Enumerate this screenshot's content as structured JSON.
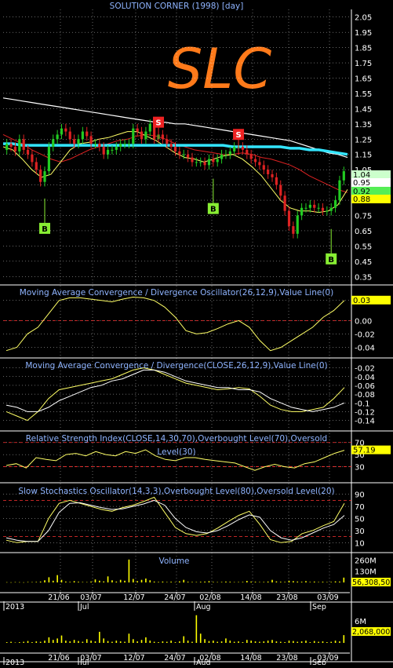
{
  "chart_title": "SOLUTION CORNER (1998) [day]",
  "logo_text": "SLC",
  "colors": {
    "background": "#000000",
    "grid": "#ffffff",
    "axis_text": "#ffffff",
    "title_text": "#8fb4ff",
    "logo": "#ff7a1a",
    "up_candle": "#22cc22",
    "down_candle": "#dd2222",
    "ma_white": "#ffffff",
    "ma_red": "#dd2222",
    "ma_yellow": "#ffff66",
    "ma_cyan": "#33e5ff",
    "signal_line": "#ffff66",
    "volume_bar": "#ffff00",
    "overbought_dash": "#ff3333",
    "buy_marker": "#88ee33",
    "sell_marker": "#ee2222",
    "price_label_current": "#ffffff",
    "price_label_other": "#ffff00",
    "last_value_green": "#99ff99"
  },
  "x_axis": {
    "date_labels": [
      "21/06",
      "03/07",
      "12/07",
      "24/07",
      "02/08",
      "14/08",
      "23/08",
      "03/09"
    ],
    "month_labels": [
      "2013",
      "Jul",
      "Aug",
      "Sep"
    ]
  },
  "chart_data": [
    {
      "type": "candlestick",
      "title": "SOLUTION CORNER (1998) [day]",
      "y_ticks": [
        "2.05",
        "1.95",
        "1.85",
        "1.75",
        "1.65",
        "1.55",
        "1.45",
        "1.35",
        "1.25",
        "1.15",
        "1.05",
        "0.95",
        "0.85",
        "0.75",
        "0.65",
        "0.55",
        "0.45",
        "0.35"
      ],
      "ylim": [
        0.3,
        2.1
      ],
      "last_price_labels": [
        "1.04",
        "0.95",
        "0.92",
        "0.88"
      ],
      "close": [
        1.22,
        1.2,
        1.17,
        1.25,
        1.18,
        1.15,
        1.1,
        1.05,
        0.97,
        1.04,
        1.2,
        1.25,
        1.28,
        1.32,
        1.3,
        1.25,
        1.22,
        1.25,
        1.3,
        1.27,
        1.22,
        1.22,
        1.2,
        1.15,
        1.18,
        1.18,
        1.2,
        1.22,
        1.22,
        1.22,
        1.32,
        1.3,
        1.25,
        1.3,
        1.35,
        1.25,
        1.28,
        1.25,
        1.22,
        1.2,
        1.17,
        1.15,
        1.15,
        1.13,
        1.1,
        1.1,
        1.1,
        1.08,
        1.12,
        1.1,
        1.12,
        1.15,
        1.15,
        1.17,
        1.2,
        1.2,
        1.18,
        1.15,
        1.12,
        1.1,
        1.08,
        1.05,
        1.02,
        1.0,
        0.95,
        0.88,
        0.78,
        0.68,
        0.63,
        0.75,
        0.8,
        0.8,
        0.82,
        0.8,
        0.8,
        0.78,
        0.78,
        0.8,
        0.85,
        0.98,
        1.04
      ],
      "open": [
        1.18,
        1.22,
        1.2,
        1.17,
        1.25,
        1.18,
        1.15,
        1.1,
        1.05,
        0.97,
        1.04,
        1.2,
        1.25,
        1.28,
        1.32,
        1.3,
        1.25,
        1.22,
        1.25,
        1.3,
        1.27,
        1.22,
        1.22,
        1.2,
        1.15,
        1.18,
        1.18,
        1.2,
        1.22,
        1.22,
        1.22,
        1.32,
        1.3,
        1.25,
        1.3,
        1.35,
        1.25,
        1.28,
        1.25,
        1.22,
        1.2,
        1.17,
        1.15,
        1.15,
        1.13,
        1.1,
        1.1,
        1.1,
        1.08,
        1.12,
        1.1,
        1.12,
        1.15,
        1.15,
        1.17,
        1.2,
        1.2,
        1.18,
        1.15,
        1.12,
        1.1,
        1.08,
        1.05,
        1.02,
        1.0,
        0.95,
        0.88,
        0.78,
        0.68,
        0.63,
        0.75,
        0.8,
        0.8,
        0.82,
        0.8,
        0.8,
        0.78,
        0.78,
        0.8,
        0.85,
        0.98
      ],
      "markers": [
        {
          "label": "B",
          "index": 9,
          "price": 0.82,
          "kind": "buy"
        },
        {
          "label": "S",
          "index": 36,
          "price": 1.32,
          "kind": "sell"
        },
        {
          "label": "B",
          "index": 49,
          "price": 0.95,
          "kind": "buy"
        },
        {
          "label": "S",
          "index": 55,
          "price": 1.24,
          "kind": "sell"
        },
        {
          "label": "B",
          "index": 77,
          "price": 0.62,
          "kind": "buy"
        }
      ]
    },
    {
      "type": "line",
      "title": "Moving Average Convergence / Divergence Oscillator(26,12,9),Value Line(0)",
      "y_ticks": [
        "0.03",
        "0.00",
        "-0.02",
        "-0.04"
      ],
      "ylim": [
        -0.05,
        0.045
      ],
      "last_value_label": "0.03",
      "series": [
        {
          "name": "Oscillator",
          "values": [
            -0.045,
            -0.04,
            -0.02,
            -0.01,
            0.01,
            0.03,
            0.034,
            0.034,
            0.032,
            0.03,
            0.028,
            0.032,
            0.035,
            0.034,
            0.03,
            0.02,
            0.005,
            -0.015,
            -0.02,
            -0.018,
            -0.012,
            -0.005,
            0.0,
            -0.01,
            -0.03,
            -0.045,
            -0.04,
            -0.03,
            -0.02,
            -0.01,
            0.005,
            0.015,
            0.03
          ]
        }
      ],
      "zero_line": 0.0
    },
    {
      "type": "line",
      "title": "Moving Average Convergence / Divergence(CLOSE,26,12,9),Value Line(0)",
      "y_ticks": [
        "-0.02",
        "-0.04",
        "-0.06",
        "-0.08",
        "-0.1",
        "-0.12",
        "-0.14"
      ],
      "ylim": [
        -0.155,
        -0.01
      ],
      "series": [
        {
          "name": "MACD",
          "values": [
            -0.12,
            -0.13,
            -0.14,
            -0.12,
            -0.09,
            -0.07,
            -0.065,
            -0.06,
            -0.055,
            -0.05,
            -0.045,
            -0.035,
            -0.025,
            -0.02,
            -0.025,
            -0.035,
            -0.045,
            -0.055,
            -0.06,
            -0.065,
            -0.07,
            -0.068,
            -0.065,
            -0.068,
            -0.085,
            -0.105,
            -0.115,
            -0.12,
            -0.12,
            -0.115,
            -0.11,
            -0.09,
            -0.065
          ]
        },
        {
          "name": "Signal",
          "values": [
            -0.105,
            -0.11,
            -0.12,
            -0.12,
            -0.11,
            -0.095,
            -0.085,
            -0.075,
            -0.065,
            -0.06,
            -0.05,
            -0.045,
            -0.035,
            -0.025,
            -0.025,
            -0.03,
            -0.04,
            -0.05,
            -0.055,
            -0.06,
            -0.065,
            -0.065,
            -0.07,
            -0.07,
            -0.075,
            -0.09,
            -0.1,
            -0.11,
            -0.115,
            -0.12,
            -0.115,
            -0.11,
            -0.1
          ]
        }
      ]
    },
    {
      "type": "line",
      "title": "Relative Strength Index(CLOSE,14,30,70),Overbought Level(70),Oversold Level(30)",
      "y_ticks": [
        "70",
        "50",
        "30"
      ],
      "ylim": [
        10,
        80
      ],
      "overbought": 70,
      "oversold": 30,
      "last_value_label": "57.19",
      "series": [
        {
          "name": "RSI",
          "values": [
            32,
            35,
            28,
            45,
            42,
            40,
            50,
            52,
            48,
            55,
            50,
            48,
            55,
            52,
            58,
            48,
            42,
            40,
            45,
            45,
            42,
            40,
            38,
            36,
            30,
            24,
            30,
            34,
            30,
            28,
            35,
            38,
            45,
            52,
            57.19
          ]
        }
      ]
    },
    {
      "type": "line",
      "title": "Slow Stochastics Oscillator(14,3,3),Overbought Level(80),Oversold Level(20)",
      "y_ticks": [
        "90",
        "70",
        "50",
        "30",
        "10"
      ],
      "ylim": [
        0,
        100
      ],
      "overbought": 80,
      "oversold": 20,
      "series": [
        {
          "name": "%K",
          "values": [
            14,
            10,
            12,
            12,
            50,
            75,
            80,
            75,
            70,
            65,
            62,
            68,
            72,
            78,
            85,
            60,
            35,
            25,
            22,
            25,
            34,
            45,
            55,
            62,
            40,
            15,
            10,
            12,
            25,
            30,
            38,
            45,
            75
          ]
        },
        {
          "name": "%D",
          "values": [
            18,
            14,
            12,
            12,
            30,
            60,
            75,
            76,
            72,
            68,
            65,
            66,
            70,
            74,
            80,
            72,
            50,
            35,
            28,
            26,
            30,
            38,
            48,
            56,
            52,
            30,
            18,
            14,
            18,
            26,
            34,
            40,
            55
          ]
        }
      ]
    },
    {
      "type": "bar",
      "title": "Volume",
      "y_ticks": [
        "260M",
        "130M"
      ],
      "ylim": [
        0,
        300
      ],
      "last_value_label": "56,308,500",
      "values": [
        3,
        2,
        4,
        3,
        2,
        5,
        4,
        6,
        10,
        25,
        60,
        20,
        85,
        30,
        10,
        6,
        15,
        8,
        5,
        4,
        10,
        35,
        20,
        12,
        70,
        25,
        10,
        30,
        20,
        265,
        40,
        15,
        30,
        45,
        25,
        10,
        6,
        10,
        5,
        8,
        4,
        12,
        30,
        8,
        6,
        5,
        8,
        10,
        15,
        6,
        4,
        6,
        10,
        8,
        4,
        5,
        6,
        18,
        10,
        8,
        5,
        6,
        10,
        30,
        12,
        8,
        6,
        20,
        15,
        10,
        8,
        15,
        6,
        10,
        5,
        8,
        4,
        6,
        12,
        10,
        56
      ]
    },
    {
      "type": "bar",
      "title": "",
      "y_ticks": [
        "6M"
      ],
      "ylim": [
        0,
        10
      ],
      "last_value_label": "2,068,000",
      "values": [
        0.2,
        0.3,
        0.1,
        0.2,
        0.3,
        0.5,
        0.2,
        0.4,
        0.3,
        0.6,
        1.5,
        0.8,
        1.2,
        2.0,
        0.6,
        0.4,
        0.8,
        0.5,
        0.3,
        1.0,
        0.6,
        0.4,
        3.0,
        1.2,
        0.5,
        0.3,
        0.6,
        0.4,
        0.3,
        2.5,
        1.0,
        0.4,
        0.8,
        1.5,
        0.6,
        0.3,
        0.2,
        0.4,
        0.3,
        0.6,
        0.2,
        0.4,
        1.8,
        0.6,
        0.3,
        7.5,
        2.5,
        1.0,
        0.5,
        0.6,
        0.3,
        0.4,
        1.2,
        0.6,
        0.3,
        0.4,
        0.2,
        0.8,
        0.6,
        0.4,
        0.3,
        0.4,
        0.6,
        0.8,
        0.4,
        0.3,
        0.2,
        0.6,
        0.5,
        0.3,
        0.4,
        0.6,
        0.2,
        0.5,
        0.3,
        0.4,
        0.2,
        0.3,
        0.6,
        0.4,
        2.1
      ]
    }
  ],
  "moving_averages": {
    "white": [
      1.52,
      1.51,
      1.5,
      1.49,
      1.48,
      1.47,
      1.46,
      1.45,
      1.44,
      1.43,
      1.42,
      1.41,
      1.4,
      1.39,
      1.38,
      1.37,
      1.36,
      1.36,
      1.35,
      1.35,
      1.34,
      1.33,
      1.32,
      1.31,
      1.3,
      1.29,
      1.28,
      1.27,
      1.26,
      1.25,
      1.24,
      1.22,
      1.2,
      1.18,
      1.16,
      1.15,
      1.13
    ],
    "cyan": [
      1.22,
      1.22,
      1.21,
      1.21,
      1.21,
      1.21,
      1.21,
      1.21,
      1.21,
      1.21,
      1.21,
      1.21,
      1.21,
      1.21,
      1.21,
      1.21,
      1.21,
      1.21,
      1.21,
      1.21,
      1.21,
      1.21,
      1.21,
      1.21,
      1.2,
      1.2,
      1.2,
      1.2,
      1.2,
      1.2,
      1.19,
      1.19,
      1.18,
      1.18,
      1.17,
      1.16,
      1.15
    ],
    "red": [
      1.28,
      1.25,
      1.22,
      1.18,
      1.15,
      1.12,
      1.1,
      1.12,
      1.15,
      1.18,
      1.2,
      1.22,
      1.24,
      1.25,
      1.27,
      1.28,
      1.27,
      1.25,
      1.22,
      1.2,
      1.18,
      1.17,
      1.16,
      1.15,
      1.15,
      1.16,
      1.15,
      1.13,
      1.12,
      1.1,
      1.08,
      1.05,
      1.01,
      0.98,
      0.95,
      0.92,
      0.9
    ],
    "yellow": [
      1.2,
      1.18,
      1.12,
      1.05,
      1.0,
      1.02,
      1.1,
      1.18,
      1.22,
      1.23,
      1.25,
      1.26,
      1.28,
      1.3,
      1.3,
      1.27,
      1.24,
      1.2,
      1.16,
      1.13,
      1.12,
      1.1,
      1.12,
      1.14,
      1.15,
      1.12,
      1.07,
      1.01,
      0.93,
      0.85,
      0.8,
      0.78,
      0.78,
      0.77,
      0.78,
      0.82,
      0.92
    ]
  }
}
